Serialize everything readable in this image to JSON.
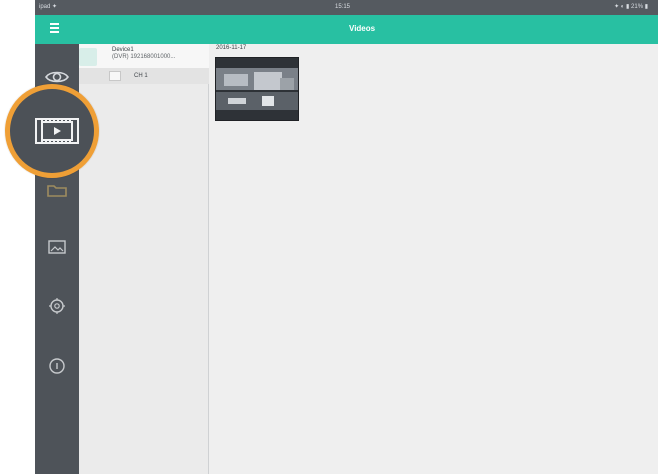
{
  "app": {
    "status_left": "ipad ✦",
    "status_time": "15:15",
    "status_right": "✦ ◐ ▮ 21% ▮",
    "title": "Videos"
  },
  "sidebar": {
    "items": [
      {
        "icon": "eye-icon",
        "active": false
      },
      {
        "icon": "video-playback-icon",
        "active": true
      },
      {
        "icon": "folder-icon",
        "active": false
      },
      {
        "icon": "image-icon",
        "active": false
      },
      {
        "icon": "gear-icon",
        "active": false
      },
      {
        "icon": "info-icon",
        "active": false
      }
    ]
  },
  "device_panel": {
    "device_name": "Device1",
    "device_subtitle": "(DVR) 192168001000...",
    "channel_label": "CH 1"
  },
  "video_area": {
    "date_label": "2016-11-17"
  },
  "colors": {
    "accent": "#28c0a2",
    "sidebar": "#4e5359",
    "callout": "#ef9f36"
  }
}
